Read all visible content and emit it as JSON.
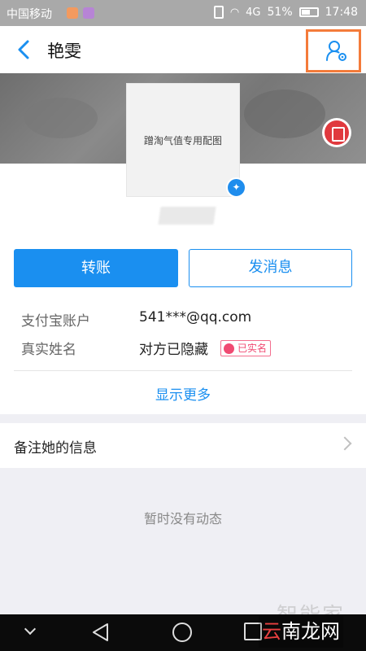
{
  "status_bar": {
    "carrier": "中国移动",
    "signal": "4G",
    "battery": "51%",
    "time": "17:48"
  },
  "nav": {
    "title": "艳雯"
  },
  "profile": {
    "avatar_text": "蹭淘气值专用配图"
  },
  "actions": {
    "transfer": "转账",
    "message": "发消息"
  },
  "info": {
    "account_label": "支付宝账户",
    "account_value": "541***@qq.com",
    "realname_label": "真实姓名",
    "realname_value": "对方已隐藏",
    "verified_tag": "已实名",
    "show_more": "显示更多"
  },
  "remark": {
    "label": "备注她的信息"
  },
  "feed": {
    "empty": "暂时没有动态"
  },
  "watermark": {
    "brand": "智能家",
    "site_a": "云",
    "site_b": "南龙网"
  },
  "colors": {
    "accent": "#1a8ff0",
    "highlight_box": "#f47b3a",
    "verified": "#f04a72"
  }
}
